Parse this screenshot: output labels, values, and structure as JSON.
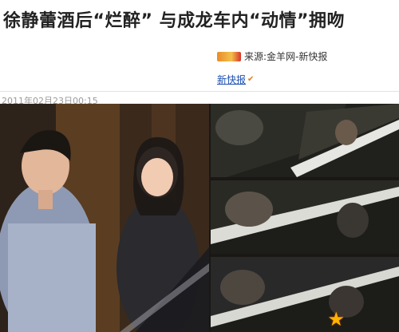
{
  "headline": "徐静蕾酒后“烂醉” 与成龙车内“动情”拥吻",
  "source": {
    "label": "来源:金羊网-新快报",
    "logo_icon": "newspaper-logo-icon"
  },
  "link": {
    "label": "新快报",
    "icon": "check-icon"
  },
  "timestamp": "2011年02月23日00:15",
  "photos": {
    "main_alt": "man-and-woman-at-door-photo",
    "side_alts": [
      "car-window-photo-1",
      "car-window-photo-2",
      "car-window-photo-3"
    ],
    "watermark_icon": "star-logo-icon"
  },
  "colors": {
    "link": "#1a4fb0",
    "timestamp": "#9a9a9a",
    "headline": "#222222",
    "logo_orange": "#e98b2a"
  }
}
